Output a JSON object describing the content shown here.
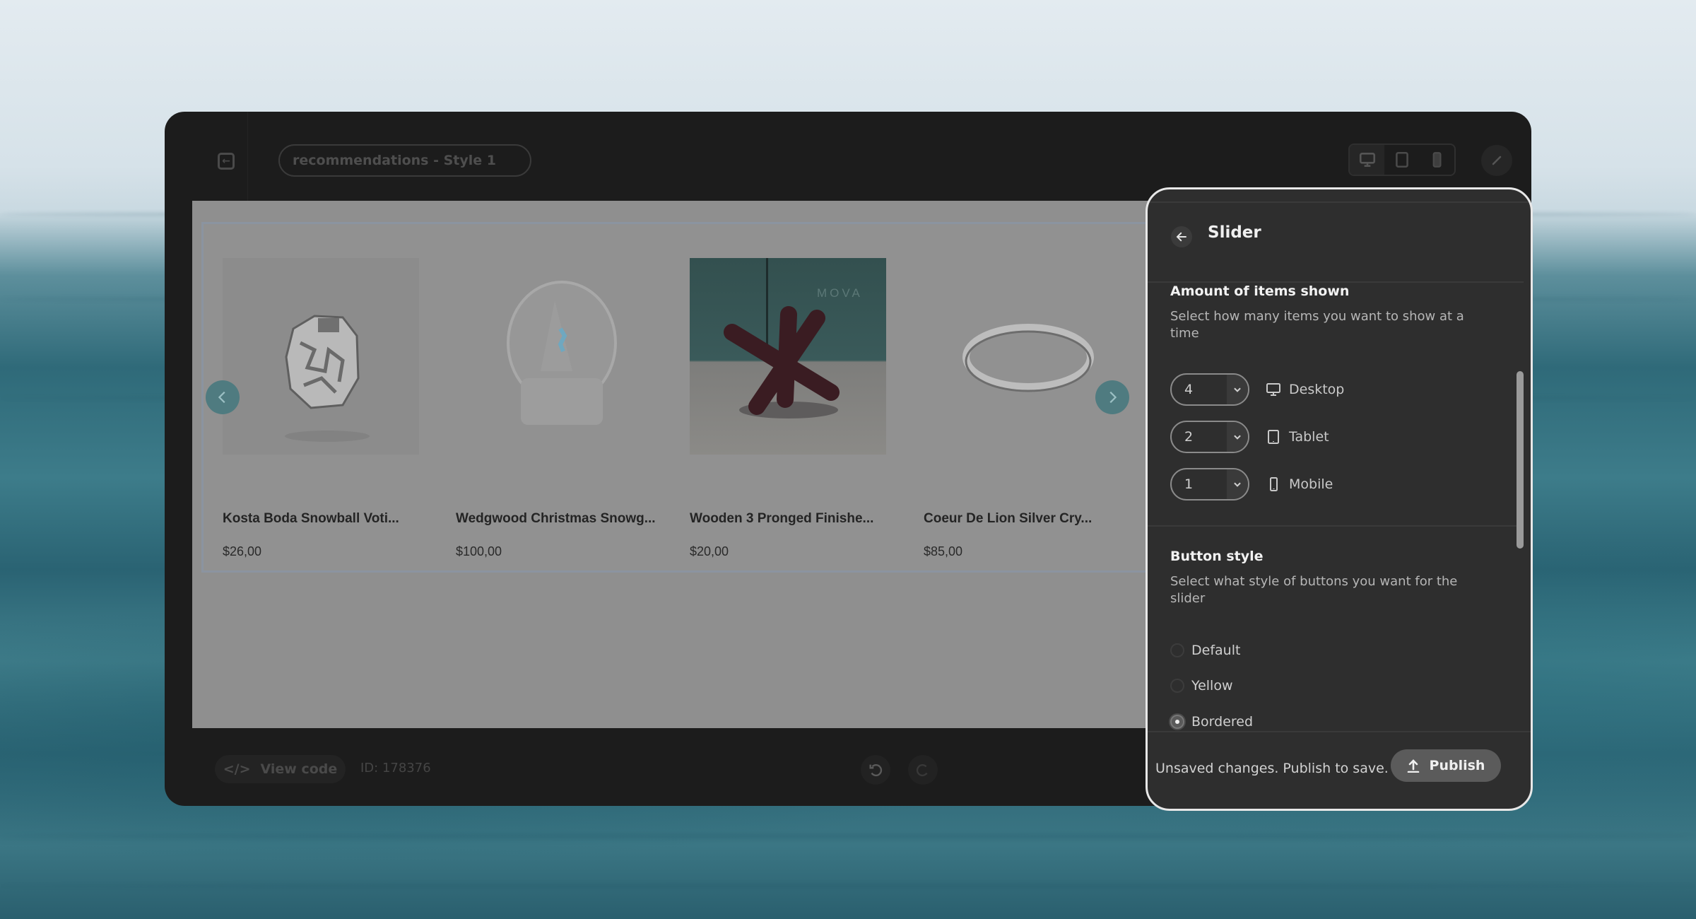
{
  "editor": {
    "title": "recommendations - Style 1",
    "device_modes": [
      "desktop",
      "tablet",
      "mobile"
    ],
    "active_device": "desktop",
    "widget_id_label": "ID: 178376",
    "view_code_label": "View code"
  },
  "preview": {
    "products": [
      {
        "name": "Kosta Boda Snowball Voti...",
        "price": "$26,00",
        "image": "crystal-votive"
      },
      {
        "name": "Wedgwood Christmas Snowg...",
        "price": "$100,00",
        "image": "snow-globe"
      },
      {
        "name": "Wooden 3 Pronged Finishe...",
        "price": "$20,00",
        "image": "wooden-sculpture"
      },
      {
        "name": "Coeur De Lion Silver Cry...",
        "price": "$85,00",
        "image": "silver-bracelet"
      }
    ],
    "watermark_text": "MOVA"
  },
  "panel": {
    "title": "Slider",
    "items_section": {
      "title": "Amount of items shown",
      "description": "Select how many items you want to show at a time",
      "rows": [
        {
          "value": "4",
          "device": "Desktop",
          "icon": "monitor-icon"
        },
        {
          "value": "2",
          "device": "Tablet",
          "icon": "tablet-icon"
        },
        {
          "value": "1",
          "device": "Mobile",
          "icon": "mobile-icon"
        }
      ]
    },
    "button_section": {
      "title": "Button style",
      "description": "Select what style of buttons you want for the slider",
      "options": [
        {
          "label": "Default",
          "checked": false
        },
        {
          "label": "Yellow",
          "checked": false
        },
        {
          "label": "Bordered",
          "checked": true
        }
      ]
    },
    "footer": {
      "status": "Unsaved changes. Publish to save.",
      "publish_label": "Publish"
    }
  },
  "colors": {
    "slider_arrow": "#4f7b80",
    "panel_bg": "#2e2e2e",
    "frame_bg": "#1c1c1c"
  }
}
